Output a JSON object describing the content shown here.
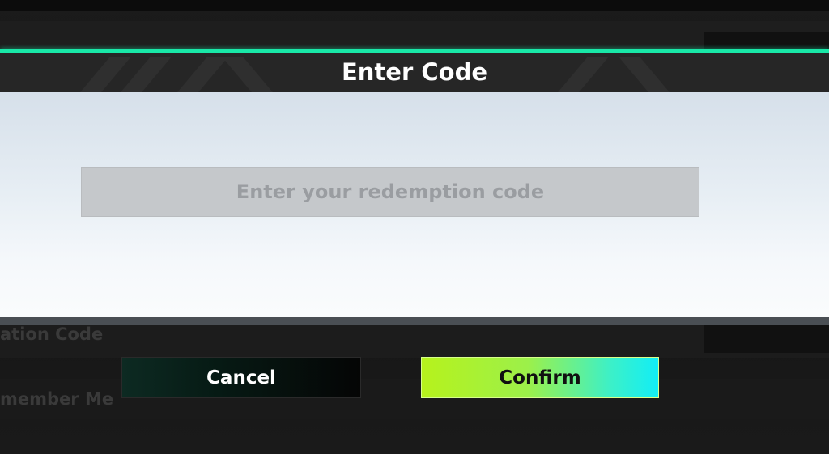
{
  "dialog": {
    "title": "Enter Code",
    "input": {
      "placeholder": "Enter your redemption code",
      "value": ""
    },
    "cancel_label": "Cancel",
    "confirm_label": "Confirm"
  },
  "background": {
    "row_text_1": "ation Code",
    "row_text_2": "member Me"
  },
  "colors": {
    "accent_line": "#19e8a8",
    "confirm_gradient_start": "#b6f21c",
    "confirm_gradient_end": "#12eef6",
    "cancel_bg": "#061a14"
  }
}
